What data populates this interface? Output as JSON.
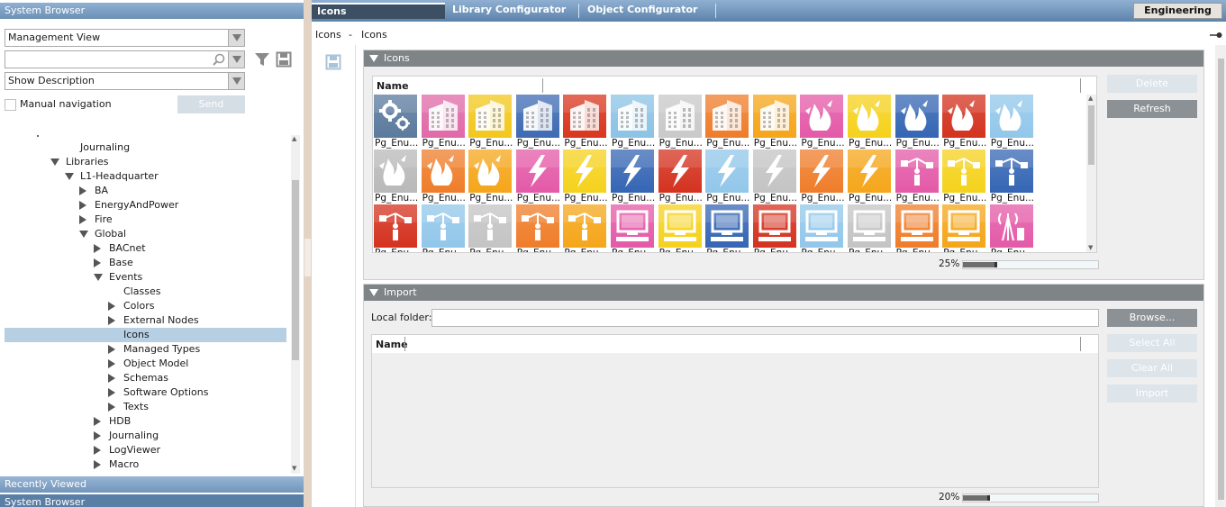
{
  "left_panel": {
    "title": "System Browser",
    "view_select": "Management View",
    "search_value": "",
    "description_select": "Show Description",
    "manual_navigation_label": "Manual navigation",
    "send_label": "Send",
    "tree": [
      {
        "label": "Journaling",
        "indent": 3,
        "expander": "none"
      },
      {
        "label": "Libraries",
        "indent": 2,
        "expander": "expanded"
      },
      {
        "label": "L1-Headquarter",
        "indent": 3,
        "expander": "expanded"
      },
      {
        "label": "BA",
        "indent": 4,
        "expander": "collapsed"
      },
      {
        "label": "EnergyAndPower",
        "indent": 4,
        "expander": "collapsed"
      },
      {
        "label": "Fire",
        "indent": 4,
        "expander": "collapsed"
      },
      {
        "label": "Global",
        "indent": 4,
        "expander": "expanded"
      },
      {
        "label": "BACnet",
        "indent": 5,
        "expander": "collapsed"
      },
      {
        "label": "Base",
        "indent": 5,
        "expander": "collapsed"
      },
      {
        "label": "Events",
        "indent": 5,
        "expander": "expanded"
      },
      {
        "label": "Classes",
        "indent": 6,
        "expander": "none"
      },
      {
        "label": "Colors",
        "indent": 6,
        "expander": "collapsed"
      },
      {
        "label": "External Nodes",
        "indent": 6,
        "expander": "collapsed"
      },
      {
        "label": "Icons",
        "indent": 6,
        "expander": "none",
        "selected": true
      },
      {
        "label": "Managed Types",
        "indent": 6,
        "expander": "collapsed"
      },
      {
        "label": "Object Model",
        "indent": 6,
        "expander": "collapsed"
      },
      {
        "label": "Schemas",
        "indent": 6,
        "expander": "collapsed"
      },
      {
        "label": "Software Options",
        "indent": 6,
        "expander": "collapsed"
      },
      {
        "label": "Texts",
        "indent": 6,
        "expander": "collapsed"
      },
      {
        "label": "HDB",
        "indent": 5,
        "expander": "collapsed"
      },
      {
        "label": "Journaling",
        "indent": 5,
        "expander": "collapsed"
      },
      {
        "label": "LogViewer",
        "indent": 5,
        "expander": "collapsed"
      },
      {
        "label": "Macro",
        "indent": 5,
        "expander": "collapsed"
      }
    ],
    "recently_viewed": "Recently Viewed",
    "system_browser_footer": "System Browser"
  },
  "tabs": [
    {
      "label": "Icons",
      "active": true
    },
    {
      "label": "Library Configurator",
      "active": false
    },
    {
      "label": "Object Configurator",
      "active": false
    }
  ],
  "mode_button": "Engineering",
  "breadcrumb": {
    "root": "Icons",
    "separator": "-",
    "current": "Icons"
  },
  "icons_panel": {
    "title": "Icons",
    "column_name": "Name",
    "delete_label": "Delete",
    "refresh_label": "Refresh",
    "zoom_percent": "25%",
    "zoom_value": 0.25,
    "icon_label": "Pg_Enu...",
    "icon_label_partial": "Pg_Enu",
    "rows": [
      [
        {
          "c": "#5b7a9d",
          "g": "gear-icon"
        },
        {
          "c": "#e06aa8",
          "g": "building-icon"
        },
        {
          "c": "#f2c81d",
          "g": "building-icon"
        },
        {
          "c": "#3f6bb3",
          "g": "building-icon"
        },
        {
          "c": "#d9361f",
          "g": "building-icon"
        },
        {
          "c": "#8cc3e6",
          "g": "building-icon"
        },
        {
          "c": "#c9c9c9",
          "g": "building-icon"
        },
        {
          "c": "#ef7d2a",
          "g": "building-icon"
        },
        {
          "c": "#f5a61a",
          "g": "building-icon"
        },
        {
          "c": "#e45aa8",
          "g": "fire-icon"
        },
        {
          "c": "#f5d21d",
          "g": "fire-icon"
        },
        {
          "c": "#3566b4",
          "g": "fire-icon"
        },
        {
          "c": "#d4321f",
          "g": "fire-icon"
        },
        {
          "c": "#92c7ea",
          "g": "fire-icon"
        }
      ],
      [
        {
          "c": "#b9b9b9",
          "g": "fire-icon"
        },
        {
          "c": "#ef7d2a",
          "g": "fire-icon"
        },
        {
          "c": "#f5a61a",
          "g": "fire-icon"
        },
        {
          "c": "#e45aa8",
          "g": "lightning-icon"
        },
        {
          "c": "#f5d21d",
          "g": "lightning-icon"
        },
        {
          "c": "#3566b4",
          "g": "lightning-icon"
        },
        {
          "c": "#d4321f",
          "g": "lightning-icon"
        },
        {
          "c": "#92c7ea",
          "g": "lightning-icon"
        },
        {
          "c": "#c4c4c4",
          "g": "lightning-icon"
        },
        {
          "c": "#ef7d2a",
          "g": "lightning-icon"
        },
        {
          "c": "#f5a61a",
          "g": "lightning-icon"
        },
        {
          "c": "#e45aa8",
          "g": "network-icon"
        },
        {
          "c": "#f5d21d",
          "g": "network-icon"
        },
        {
          "c": "#3566b4",
          "g": "network-icon"
        }
      ],
      [
        {
          "c": "#d4321f",
          "g": "network-icon"
        },
        {
          "c": "#92c7ea",
          "g": "network-icon"
        },
        {
          "c": "#c4c4c4",
          "g": "network-icon"
        },
        {
          "c": "#ef7d2a",
          "g": "network-icon"
        },
        {
          "c": "#f5a61a",
          "g": "network-icon"
        },
        {
          "c": "#e45aa8",
          "g": "computer-icon"
        },
        {
          "c": "#f5d21d",
          "g": "computer-icon"
        },
        {
          "c": "#3566b4",
          "g": "computer-icon"
        },
        {
          "c": "#d4321f",
          "g": "computer-icon"
        },
        {
          "c": "#92c7ea",
          "g": "computer-icon"
        },
        {
          "c": "#c4c4c4",
          "g": "computer-icon"
        },
        {
          "c": "#ef7d2a",
          "g": "computer-icon"
        },
        {
          "c": "#f5a61a",
          "g": "computer-icon"
        },
        {
          "c": "#e45aa8",
          "g": "antenna-icon"
        }
      ]
    ]
  },
  "import_panel": {
    "title": "Import",
    "local_folder_label": "Local folder:",
    "local_folder_value": "",
    "browse_label": "Browse...",
    "column_name": "Name",
    "select_all_label": "Select All",
    "clear_all_label": "Clear All",
    "import_label": "Import",
    "zoom_percent": "20%",
    "zoom_value": 0.2
  }
}
